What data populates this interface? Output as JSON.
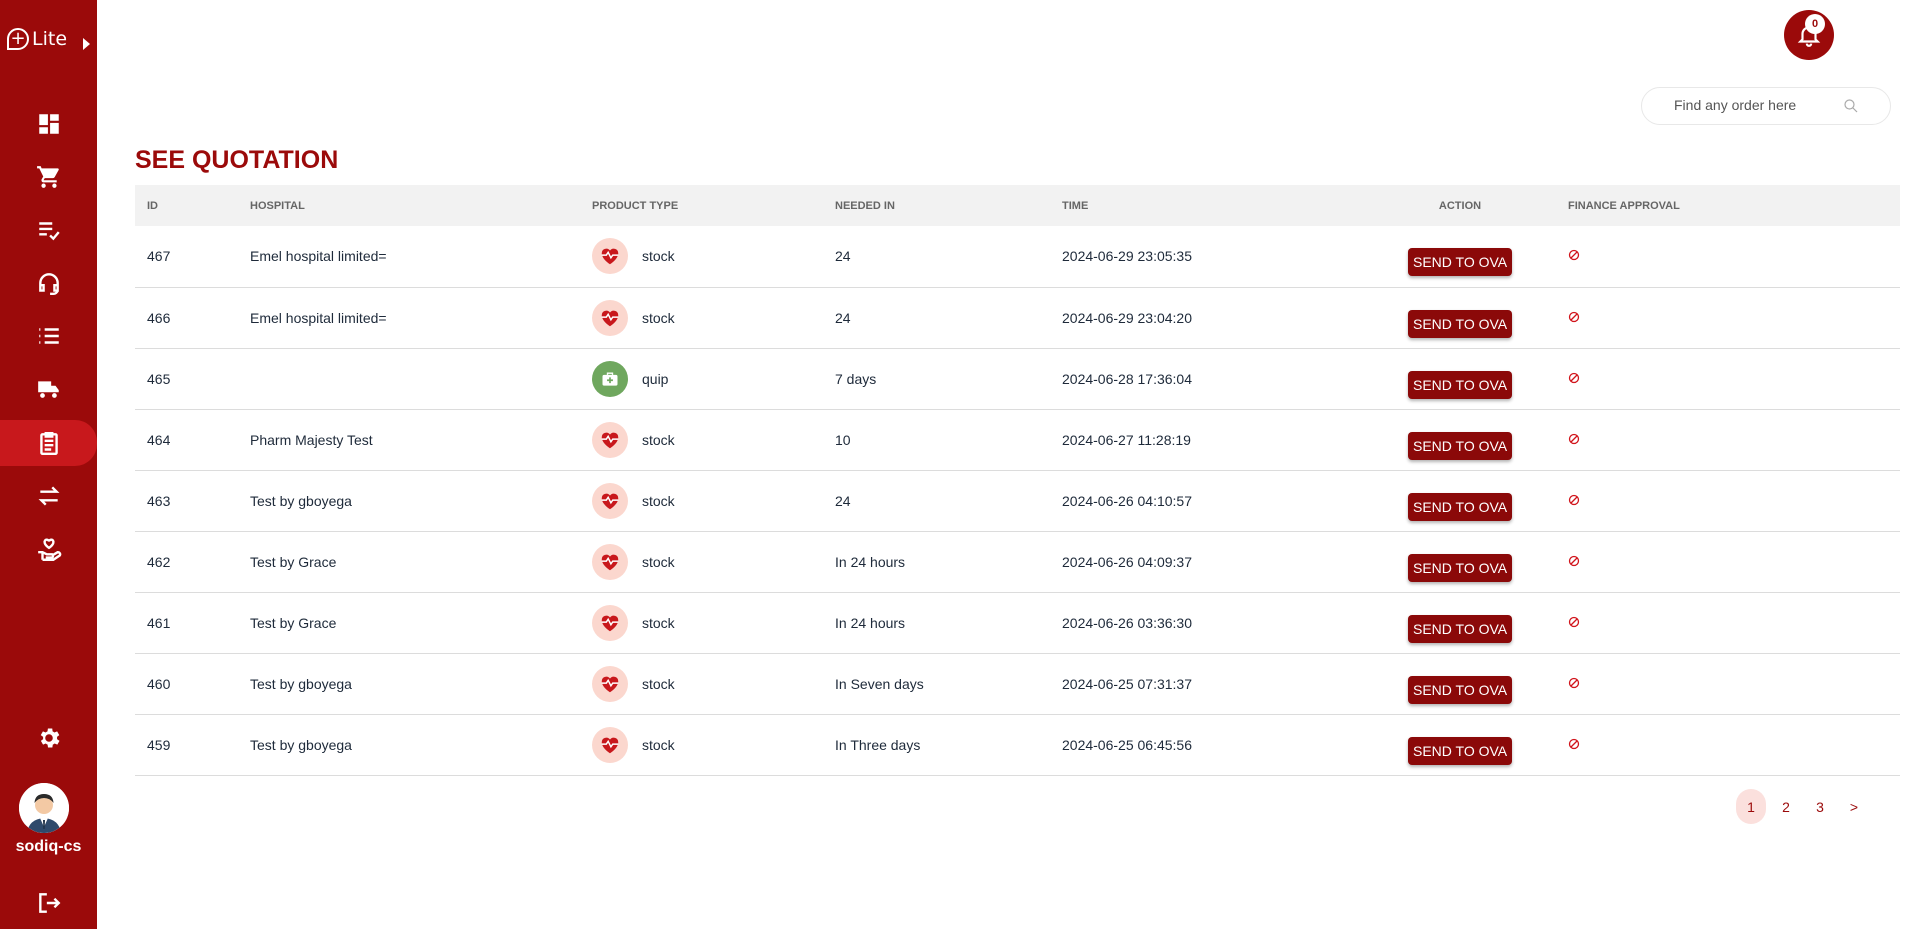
{
  "app": {
    "logo_text": "Lite"
  },
  "sidebar": {
    "items": [
      {
        "name": "dashboard-icon"
      },
      {
        "name": "cart-icon"
      },
      {
        "name": "checklist-icon"
      },
      {
        "name": "headset-icon"
      },
      {
        "name": "list-icon"
      },
      {
        "name": "delivery-truck-icon"
      },
      {
        "name": "clipboard-icon",
        "active": true
      },
      {
        "name": "transfer-icon"
      },
      {
        "name": "hand-heart-icon"
      }
    ],
    "settings_icon": "gear-icon",
    "username": "sodiq-cs",
    "logout_icon": "logout-icon"
  },
  "header": {
    "notification_count": "0"
  },
  "search": {
    "placeholder": "Find any order here"
  },
  "page": {
    "title": "SEE QUOTATION"
  },
  "table": {
    "columns": [
      "ID",
      "HOSPITAL",
      "PRODUCT TYPE",
      "NEEDED IN",
      "TIME",
      "ACTION",
      "FINANCE APPROVAL"
    ],
    "action_label": "SEND TO OVA",
    "rows": [
      {
        "id": "467",
        "hospital": "Emel hospital limited=",
        "type": "stock",
        "needed": "24",
        "time": "2024-06-29 23:05:35"
      },
      {
        "id": "466",
        "hospital": "Emel hospital limited=",
        "type": "stock",
        "needed": "24",
        "time": "2024-06-29 23:04:20"
      },
      {
        "id": "465",
        "hospital": "",
        "type": "quip",
        "needed": "7 days",
        "time": "2024-06-28 17:36:04"
      },
      {
        "id": "464",
        "hospital": "Pharm Majesty Test",
        "type": "stock",
        "needed": "10",
        "time": "2024-06-27 11:28:19"
      },
      {
        "id": "463",
        "hospital": "Test by gboyega",
        "type": "stock",
        "needed": "24",
        "time": "2024-06-26 04:10:57"
      },
      {
        "id": "462",
        "hospital": "Test by Grace",
        "type": "stock",
        "needed": "In 24 hours",
        "time": "2024-06-26 04:09:37"
      },
      {
        "id": "461",
        "hospital": "Test by Grace",
        "type": "stock",
        "needed": "In 24 hours",
        "time": "2024-06-26 03:36:30"
      },
      {
        "id": "460",
        "hospital": "Test by gboyega",
        "type": "stock",
        "needed": "In Seven days",
        "time": "2024-06-25 07:31:37"
      },
      {
        "id": "459",
        "hospital": "Test by gboyega",
        "type": "stock",
        "needed": "In Three days",
        "time": "2024-06-25 06:45:56"
      }
    ]
  },
  "pagination": {
    "pages": [
      "1",
      "2",
      "3"
    ],
    "next": ">",
    "current": "1"
  },
  "colors": {
    "brand": "#9b0a0a",
    "active_nav": "#c8181c",
    "stock_icon_bg": "#fbd7ce",
    "quip_icon_bg": "#6fa75e"
  }
}
